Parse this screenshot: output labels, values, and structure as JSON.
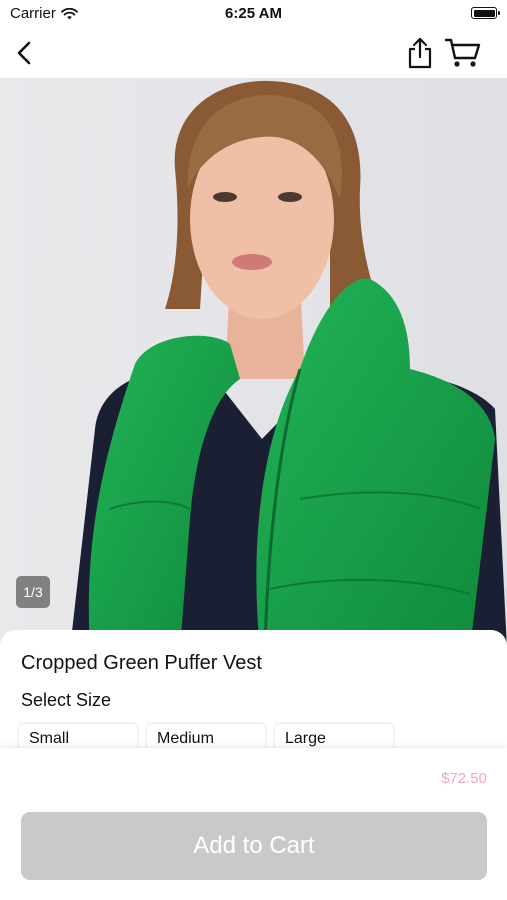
{
  "status_bar": {
    "carrier": "Carrier",
    "time": "6:25 AM",
    "icons": [
      "wifi-icon",
      "battery-icon"
    ]
  },
  "nav_bar": {
    "icons": [
      "back-chevron-icon",
      "share-icon",
      "cart-icon"
    ]
  },
  "gallery": {
    "page_indicator": "1/3",
    "image_description_colors": {
      "vest": "#17a04a",
      "sweater": "#1a1f33",
      "background": "#e7e7ea"
    }
  },
  "product": {
    "title": "Cropped Green Puffer Vest",
    "size_heading": "Select Size",
    "sizes": [
      "Small",
      "Medium",
      "Large"
    ],
    "price": "$72.50",
    "add_to_cart_label": "Add to Cart"
  },
  "colors": {
    "price": "#f2a6c4",
    "button_disabled": "#c9c9c9"
  }
}
